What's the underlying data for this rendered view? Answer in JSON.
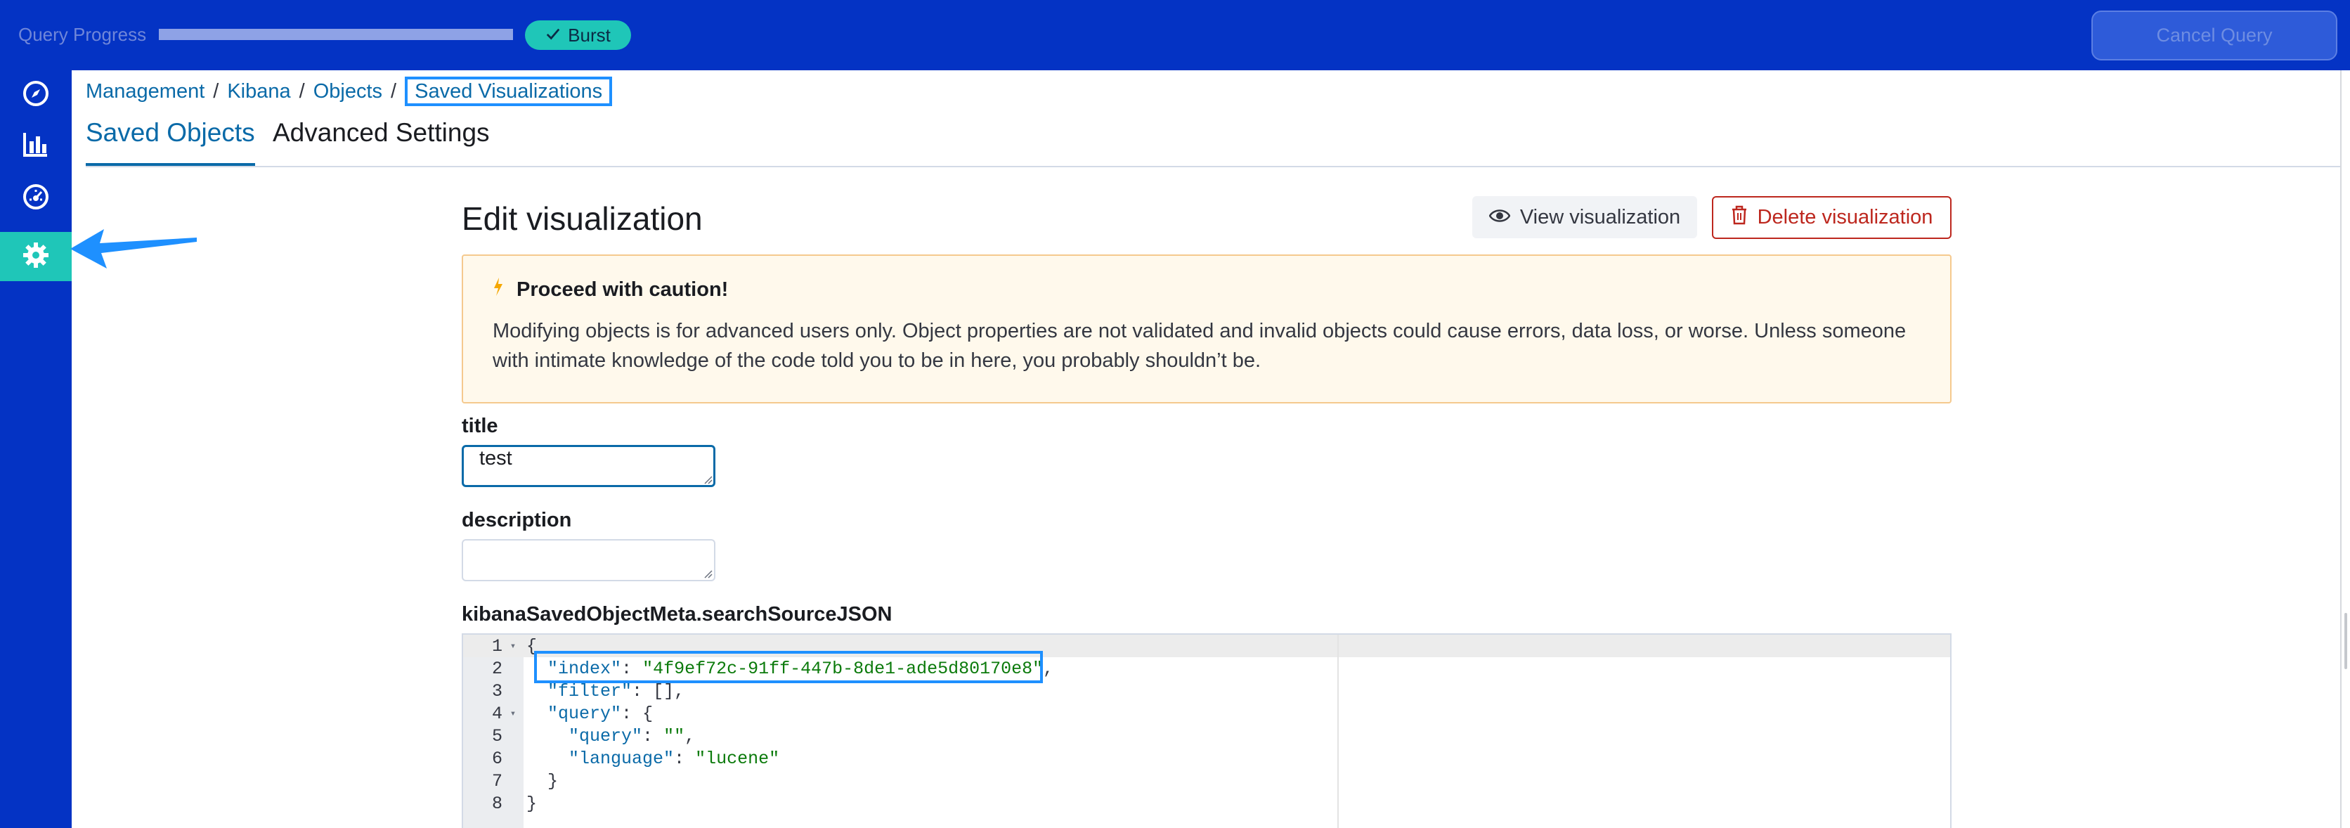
{
  "topbar": {
    "query_progress_label": "Query Progress",
    "query_progress": 1.0,
    "burst_label": "Burst",
    "cancel_label": "Cancel Query"
  },
  "sidebar": {
    "items": [
      {
        "icon": "compass-icon",
        "active": false
      },
      {
        "icon": "bar-chart-icon",
        "active": false
      },
      {
        "icon": "gauge-icon",
        "active": false
      },
      {
        "icon": "gear-icon",
        "active": true
      }
    ]
  },
  "breadcrumb": {
    "items": [
      "Management",
      "Kibana",
      "Objects"
    ],
    "separator": "/",
    "current": "Saved Visualizations"
  },
  "tabs": [
    {
      "label": "Saved Objects",
      "selected": true
    },
    {
      "label": "Advanced Settings",
      "selected": false
    }
  ],
  "main": {
    "title": "Edit visualization",
    "view_button": "View visualization",
    "delete_button": "Delete visualization",
    "callout": {
      "title": "Proceed with caution!",
      "body": "Modifying objects is for advanced users only. Object properties are not validated and invalid objects could cause errors, data loss, or worse. Unless someone with intimate knowledge of the code told you to be in here, you probably shouldn’t be."
    },
    "fields": {
      "title_label": "title",
      "title_value": "test",
      "description_label": "description",
      "description_value": "",
      "json_label": "kibanaSavedObjectMeta.searchSourceJSON"
    },
    "editor": {
      "lines": [
        {
          "n": "1",
          "fold": "▾",
          "text": "{"
        },
        {
          "n": "2",
          "fold": "",
          "key": "\"index\"",
          "value": "\"4f9ef72c-91ff-447b-8de1-ade5d80170e8\"",
          "indent": "  ",
          "tail": ","
        },
        {
          "n": "3",
          "fold": "",
          "key": "\"filter\"",
          "value": "[]",
          "indent": "  ",
          "tail": ","
        },
        {
          "n": "4",
          "fold": "▾",
          "key": "\"query\"",
          "value": "{",
          "indent": "  ",
          "tail": ""
        },
        {
          "n": "5",
          "fold": "",
          "key": "\"query\"",
          "value": "\"\"",
          "indent": "    ",
          "tail": ","
        },
        {
          "n": "6",
          "fold": "",
          "key": "\"language\"",
          "value": "\"lucene\"",
          "indent": "    ",
          "tail": ""
        },
        {
          "n": "7",
          "fold": "",
          "text": "  }"
        },
        {
          "n": "8",
          "fold": "",
          "text": "}"
        }
      ]
    }
  },
  "colors": {
    "brand_blue": "#0433c4",
    "accent_teal": "#1fc6b8",
    "link": "#0a6aa8",
    "danger": "#bd271e",
    "highlight": "#1e90ff"
  }
}
